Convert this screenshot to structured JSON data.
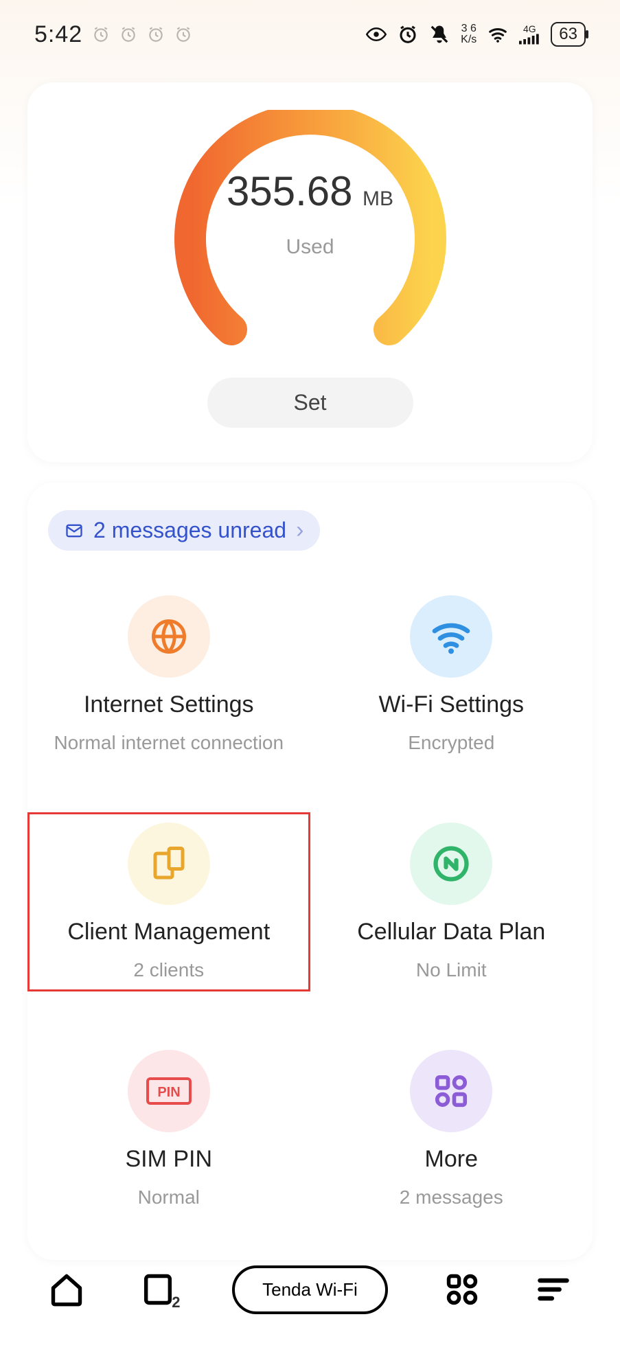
{
  "status": {
    "time": "5:42",
    "net_rate_top": "3   6",
    "net_rate_bot": "K/s",
    "cell_label": "4G",
    "battery": "63"
  },
  "gauge": {
    "value": "355.68",
    "unit": "MB",
    "label": "Used",
    "set_button": "Set"
  },
  "messages_pill": "2 messages unread",
  "tiles": {
    "internet": {
      "title": "Internet Settings",
      "sub": "Normal internet connection",
      "icon": "globe-icon"
    },
    "wifi": {
      "title": "Wi-Fi Settings",
      "sub": "Encrypted",
      "icon": "wifi-icon"
    },
    "clients": {
      "title": "Client Management",
      "sub": "2 clients",
      "icon": "devices-icon"
    },
    "data_plan": {
      "title": "Cellular Data Plan",
      "sub": "No Limit",
      "icon": "data-plan-icon"
    },
    "sim_pin": {
      "title": "SIM PIN",
      "sub": "Normal",
      "icon": "pin-icon"
    },
    "more": {
      "title": "More",
      "sub": "2 messages",
      "icon": "more-grid-icon"
    }
  },
  "nav": {
    "app_label": "Tenda Wi-Fi",
    "recent_badge": "2"
  }
}
